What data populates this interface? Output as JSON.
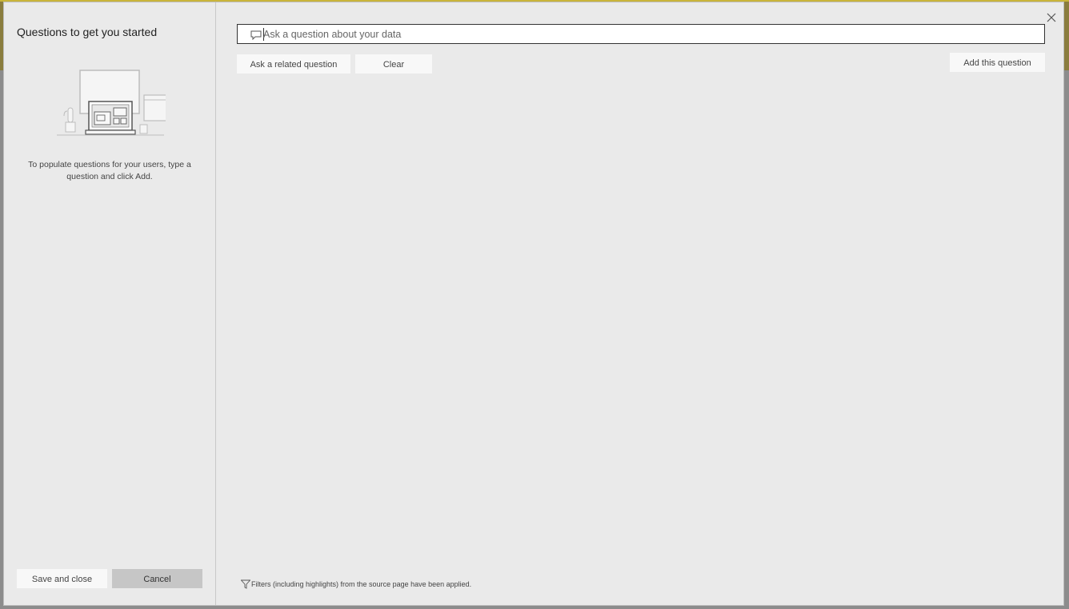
{
  "left_pane": {
    "title": "Questions to get you started",
    "help_text": "To populate questions for your users, type a question and click Add.",
    "save_label": "Save and close",
    "cancel_label": "Cancel"
  },
  "search": {
    "placeholder": "Ask a question about your data",
    "value": "",
    "icon": "speech-bubble-icon"
  },
  "toolbar": {
    "related_label": "Ask a related question",
    "clear_label": "Clear",
    "add_label": "Add this question"
  },
  "footer": {
    "filter_note": "Filters (including highlights) from the source page have been applied.",
    "filter_icon": "filter-icon"
  },
  "close_icon": "close-icon",
  "colors": {
    "dialog_bg": "#eaeaea",
    "button_bg": "#f8f8f8",
    "cancel_bg": "#c6c6c6"
  }
}
